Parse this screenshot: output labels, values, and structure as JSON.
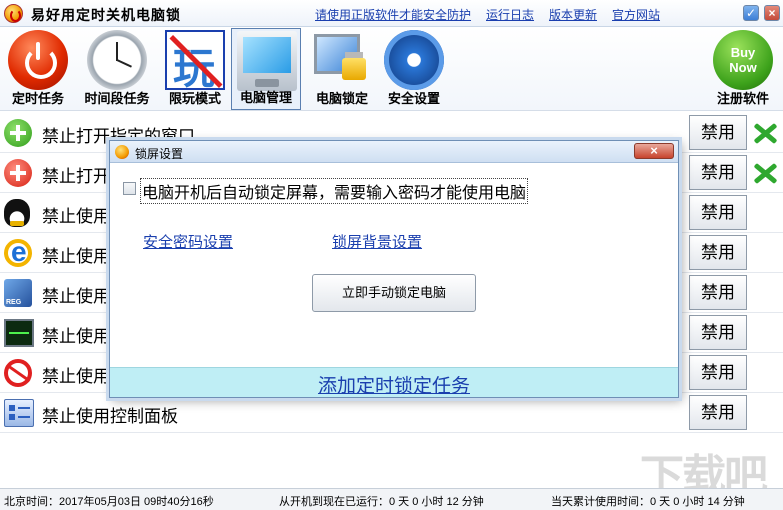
{
  "app": {
    "title": "易好用定时关机电脑锁",
    "links": [
      "请使用正版软件才能安全防护",
      "运行日志",
      "版本更新",
      "官方网站"
    ],
    "window_controls": {
      "minimize": "✓",
      "close": "×"
    }
  },
  "toolbar": {
    "items": [
      {
        "label": "定时任务",
        "icon": "power-icon"
      },
      {
        "label": "时间段任务",
        "icon": "clock-icon"
      },
      {
        "label": "限玩模式",
        "icon": "no-game-icon"
      },
      {
        "label": "电脑管理",
        "icon": "monitor-icon",
        "active": true
      },
      {
        "label": "电脑锁定",
        "icon": "lock-icon"
      },
      {
        "label": "安全设置",
        "icon": "gear-icon"
      }
    ],
    "register": {
      "label": "注册软件",
      "badge_line1": "Buy",
      "badge_line2": "Now"
    }
  },
  "list": {
    "rows": [
      {
        "text": "禁止打开指定的窗口",
        "button": "禁用",
        "icon": "add-icon"
      },
      {
        "text": "禁止打开",
        "button": "禁用",
        "icon": "red-add-icon"
      },
      {
        "text": "禁止使用",
        "button": "禁用",
        "icon": "qq-icon"
      },
      {
        "text": "禁止使用",
        "button": "禁用",
        "icon": "ie-icon"
      },
      {
        "text": "禁止使用",
        "button": "禁用",
        "icon": "registry-icon"
      },
      {
        "text": "禁止使用",
        "button": "禁用",
        "icon": "task-manager-icon"
      },
      {
        "text": "禁止使用",
        "button": "禁用",
        "icon": "no-proxy-icon"
      },
      {
        "text": "禁止使用控制面板",
        "button": "禁用",
        "icon": "control-panel-icon"
      }
    ]
  },
  "dialog": {
    "title": "锁屏设置",
    "close": "×",
    "checkbox_label": "电脑开机后自动锁定屏幕，需要输入密码才能使用电脑",
    "checkbox_checked": false,
    "link_password": "安全密码设置",
    "link_background": "锁屏背景设置",
    "lock_button": "立即手动锁定电脑",
    "footer_link": "添加定时锁定任务"
  },
  "status": {
    "beijing_time": "北京时间：2017年05月03日  09时40分16秒",
    "since_boot": "从开机到现在已运行：0 天 0 小时 12 分钟",
    "today_usage": "当天累计使用时间：0 天 0 小时 14 分钟"
  },
  "watermark": "下载吧",
  "colors": {
    "link": "#1a3fae",
    "dialog_footer_bg": "#bfeef5",
    "accent_border": "#6f8fb5"
  }
}
